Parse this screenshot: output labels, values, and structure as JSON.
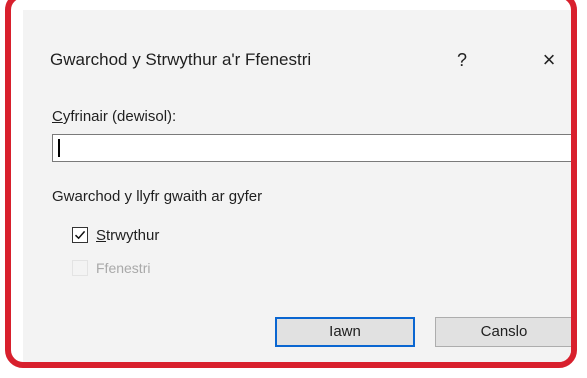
{
  "dialog": {
    "title": "Gwarchod y Strwythur a'r Ffenestri",
    "help_glyph": "?",
    "close_glyph": "×",
    "password": {
      "label_mnemonic": "C",
      "label_rest": "yfrinair (dewisol):",
      "value": ""
    },
    "protect_group_label": "Gwarchod y llyfr gwaith ar gyfer",
    "options": [
      {
        "mnemonic": "S",
        "label_rest": "trwythur",
        "checked": true,
        "enabled": true
      },
      {
        "label": "Ffenestri",
        "checked": false,
        "enabled": false
      }
    ],
    "ok_label": "Iawn",
    "cancel_label": "Canslo"
  },
  "colors": {
    "frame_border": "#d8202d",
    "dialog_bg": "#f3f3f3",
    "default_button_border": "#0a66d1"
  },
  "icons": {
    "help": "question-mark-icon",
    "close": "close-icon",
    "checkbox_checked": "checkmark-icon"
  }
}
